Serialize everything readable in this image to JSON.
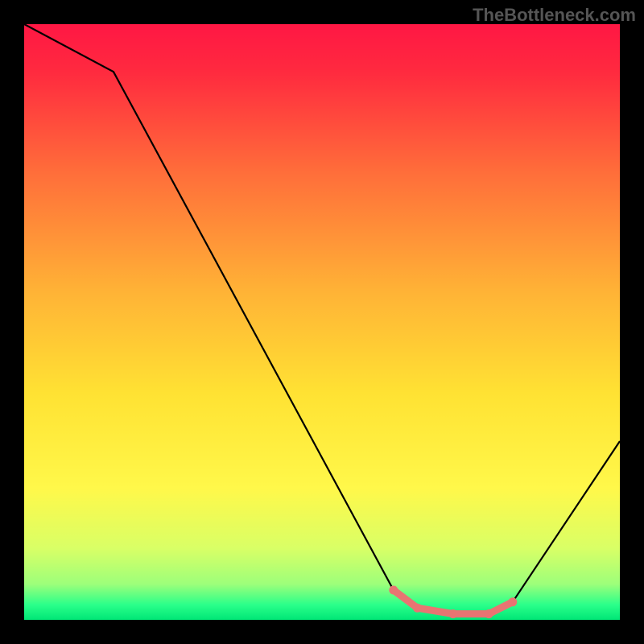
{
  "watermark": "TheBottleneck.com",
  "chart_data": {
    "type": "line",
    "title": "",
    "xlabel": "",
    "ylabel": "",
    "xlim": [
      0,
      100
    ],
    "ylim": [
      0,
      100
    ],
    "x": [
      0,
      15,
      62,
      66,
      72,
      78,
      82,
      100
    ],
    "values": [
      100,
      92,
      5,
      2,
      1,
      1,
      3,
      30
    ],
    "highlight_segment": {
      "x": [
        62,
        66,
        72,
        78,
        82
      ],
      "values": [
        5,
        2,
        1,
        1,
        3
      ],
      "color": "#e87472"
    },
    "gradient_stops": [
      {
        "offset": 0.0,
        "color": "#ff1744"
      },
      {
        "offset": 0.08,
        "color": "#ff2a3f"
      },
      {
        "offset": 0.25,
        "color": "#ff6e3a"
      },
      {
        "offset": 0.45,
        "color": "#ffb336"
      },
      {
        "offset": 0.62,
        "color": "#ffe233"
      },
      {
        "offset": 0.78,
        "color": "#fff84a"
      },
      {
        "offset": 0.88,
        "color": "#d9ff66"
      },
      {
        "offset": 0.94,
        "color": "#9dff7a"
      },
      {
        "offset": 0.975,
        "color": "#2aff8a"
      },
      {
        "offset": 1.0,
        "color": "#00e676"
      }
    ]
  }
}
